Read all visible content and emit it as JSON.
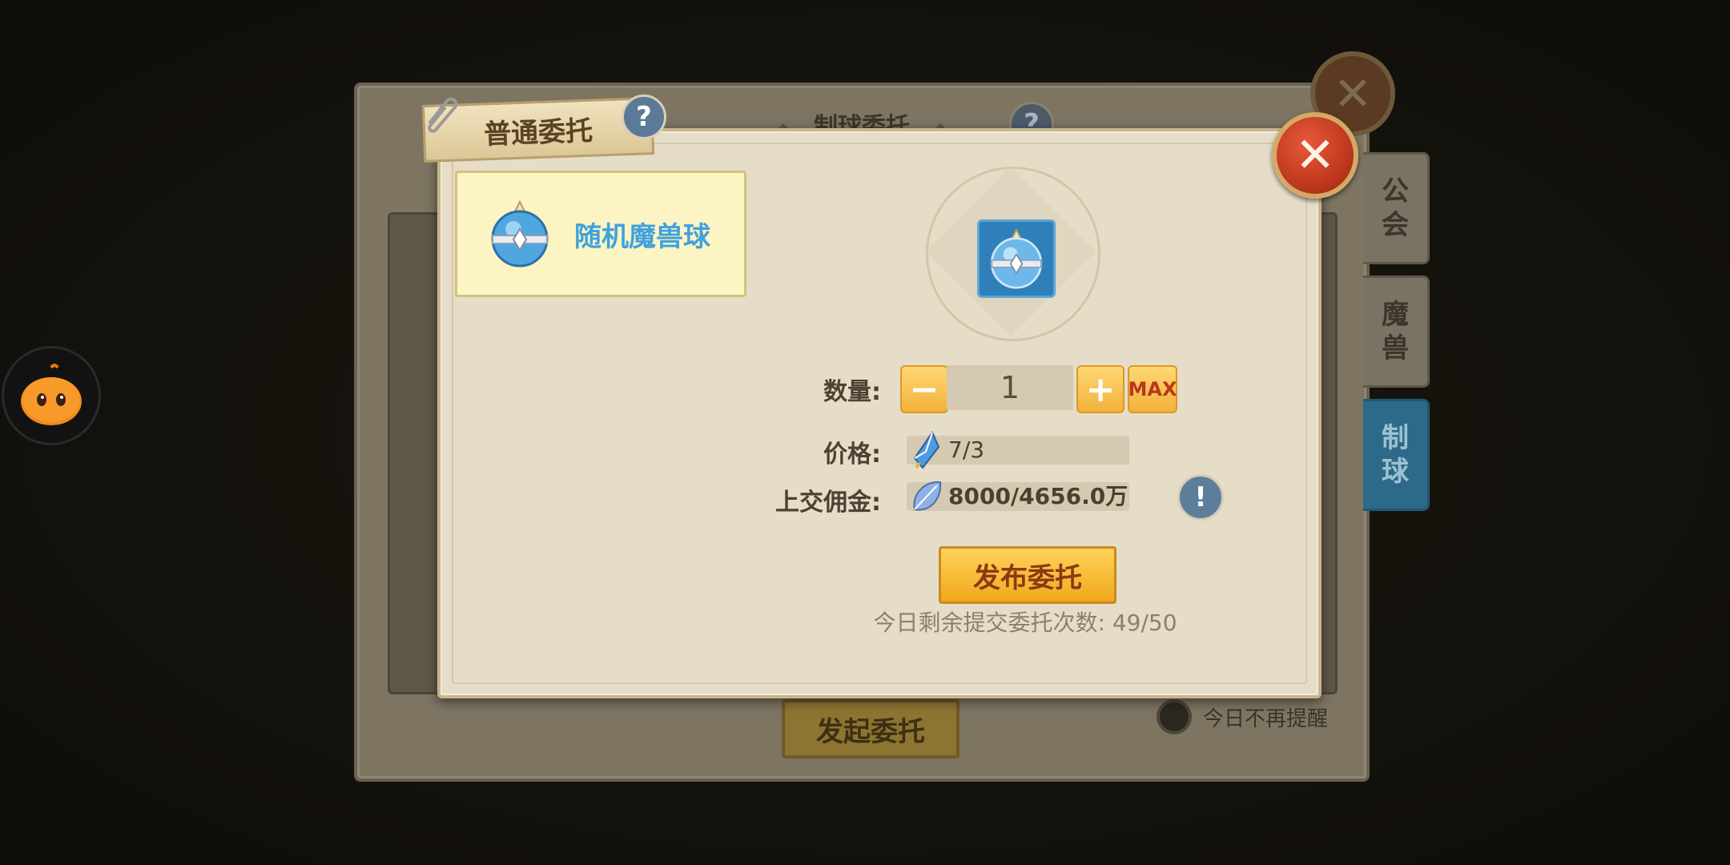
{
  "background_window": {
    "title": "制球委托",
    "submit_label": "发起委托",
    "remind_label": "今日不再提醒"
  },
  "side_tabs": [
    {
      "label_line1": "公",
      "label_line2": "会",
      "active": false
    },
    {
      "label_line1": "魔",
      "label_line2": "兽",
      "active": false
    },
    {
      "label_line1": "制",
      "label_line2": "球",
      "active": true
    }
  ],
  "dialog": {
    "ribbon_title": "普通委托",
    "item_name": "随机魔兽球",
    "quantity_label": "数量:",
    "quantity_value": "1",
    "max_label": "MAX",
    "price_label": "价格:",
    "price_value": "7/3",
    "commission_label": "上交佣金:",
    "commission_value": "8000/4656.0万",
    "publish_label": "发布委托",
    "remaining_text": "今日剩余提交委托次数: 49/50"
  },
  "icons": {
    "close": "close-icon",
    "help": "help-icon",
    "info": "exclamation-icon",
    "plus": "+",
    "minus": "−"
  },
  "colors": {
    "accent_orange": "#f2b13a",
    "item_blue": "#3fa2de",
    "close_red": "#c0381e"
  }
}
